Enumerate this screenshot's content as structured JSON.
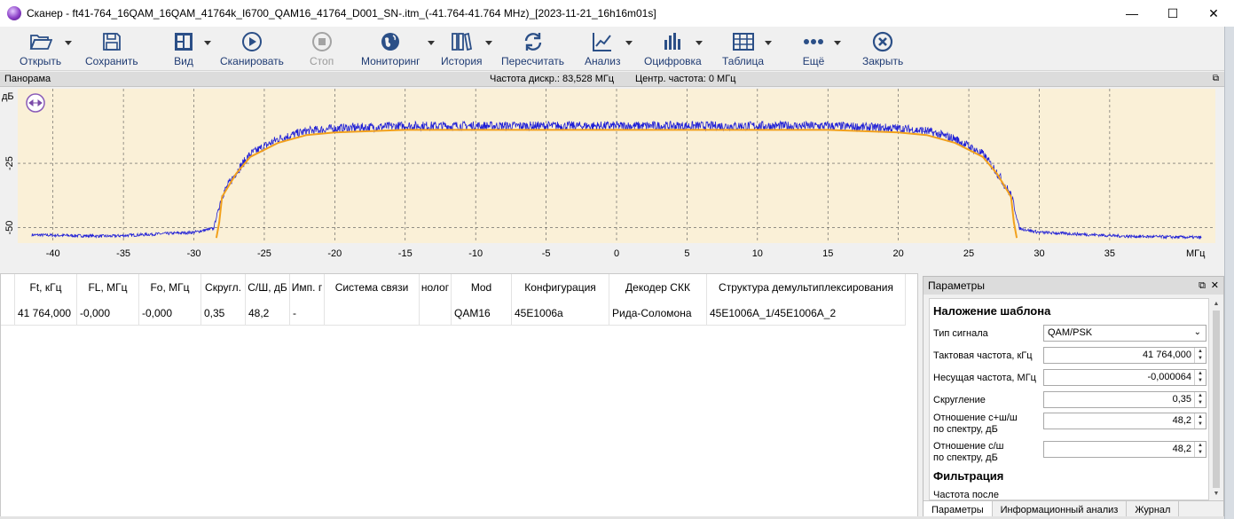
{
  "window": {
    "title": "Сканер - ft41-764_16QAM_16QAM_41764k_I6700_QAM16_41764_D001_SN-.itm_(-41.764-41.764 MHz)_[2023-11-21_16h16m01s]",
    "minimize": "—",
    "maximize": "☐",
    "close": "✕"
  },
  "toolbar": {
    "open": "Открыть",
    "save": "Сохранить",
    "view": "Вид",
    "scan": "Сканировать",
    "stop": "Стоп",
    "monitoring": "Мониторинг",
    "history": "История",
    "recalc": "Пересчитать",
    "analysis": "Анализ",
    "digitize": "Оцифровка",
    "table": "Таблица",
    "more": "Ещё",
    "close": "Закрыть"
  },
  "panorama": {
    "title": "Панорама",
    "sample_rate": "Частота дискр.: 83,528 МГц",
    "center_freq": "Центр. частота: 0 МГц",
    "float_icon": "⧉"
  },
  "chart_data": {
    "type": "line",
    "xlabel": "МГц",
    "ylabel": "дБ",
    "xlim": [
      -42.5,
      42.5
    ],
    "ylim": [
      -56,
      4
    ],
    "x_ticks": [
      -40,
      -35,
      -30,
      -25,
      -20,
      -15,
      -10,
      -5,
      0,
      5,
      10,
      15,
      20,
      25,
      30,
      35
    ],
    "x_tick_labels": [
      "-40",
      "-35",
      "-30",
      "-25",
      "-20",
      "-15",
      "-10",
      "-5",
      "0",
      "5",
      "10",
      "15",
      "20",
      "25",
      "30",
      "35"
    ],
    "y_ticks": [
      -25,
      -50
    ],
    "y_tick_labels": [
      "-25",
      "-50"
    ],
    "grid": true,
    "background": "#faf0d7",
    "series": [
      {
        "color": "#1f1fd6",
        "x": [
          -41.5,
          -36,
          -30,
          -28.6,
          -28.4,
          -28,
          -27,
          -26,
          -24,
          -22,
          -20,
          -15,
          -10,
          -5,
          0,
          5,
          10,
          15,
          20,
          22,
          24,
          26,
          27,
          28,
          28.4,
          28.6,
          30,
          36,
          41.5
        ],
        "y": [
          -53,
          -53.5,
          -52,
          -50.5,
          -46,
          -38,
          -29,
          -22,
          -16,
          -13,
          -12,
          -11,
          -11,
          -11,
          -11,
          -11,
          -11,
          -11,
          -12,
          -13,
          -16,
          -22,
          -29,
          -38,
          -46,
          -50.5,
          -52,
          -53.5,
          -54
        ]
      },
      {
        "color": "#f2a11c",
        "x": [
          -28.4,
          -28.2,
          -28,
          -27,
          -26,
          -24,
          -22,
          -20,
          -15,
          -10,
          -5,
          0,
          5,
          10,
          15,
          20,
          22,
          24,
          26,
          27,
          28,
          28.2,
          28.4
        ],
        "y": [
          -54,
          -48,
          -38,
          -29,
          -22.5,
          -17,
          -14,
          -13,
          -12,
          -12,
          -12,
          -12,
          -12,
          -12,
          -12,
          -13,
          -14,
          -17,
          -22.5,
          -29,
          -38,
          -48,
          -54
        ]
      }
    ]
  },
  "table": {
    "columns": [
      "Ft, кГц",
      "FL, МГц",
      "Fo, МГц",
      "Скругл.",
      "С/Ш, дБ",
      "Имп. г",
      "Система связи",
      "нолог",
      "Mod",
      "Конфигурация",
      "Декодер СКК",
      "Структура демультиплексирования"
    ],
    "rows": [
      [
        "41 764,000",
        "-0,000",
        "-0,000",
        "0,35",
        "48,2",
        "-",
        "",
        "",
        "QAM16",
        "45E1006a",
        "Рида-Соломона",
        "45E1006A_1/45E1006A_2"
      ]
    ]
  },
  "params": {
    "title": "Параметры",
    "section_overlay": "Наложение шаблона",
    "signal_type_label": "Тип сигнала",
    "signal_type_value": "QAM/PSK",
    "clock_label": "Тактовая частота, кГц",
    "clock_value": "41 764,000",
    "carrier_label": "Несущая частота, МГц",
    "carrier_value": "-0,000064",
    "rolloff_label": "Скругление",
    "rolloff_value": "0,35",
    "cnr_label_1": "Отношение с+ш/ш",
    "cnr_label_2": "по спектру, дБ",
    "cnr_value": "48,2",
    "snr_label_1": "Отношение с/ш",
    "snr_label_2": "по спектру, дБ",
    "snr_value": "48,2",
    "section_filter": "Фильтрация",
    "freq_after_label": "Частота после",
    "tabs": [
      "Параметры",
      "Информационный анализ",
      "Журнал"
    ]
  }
}
